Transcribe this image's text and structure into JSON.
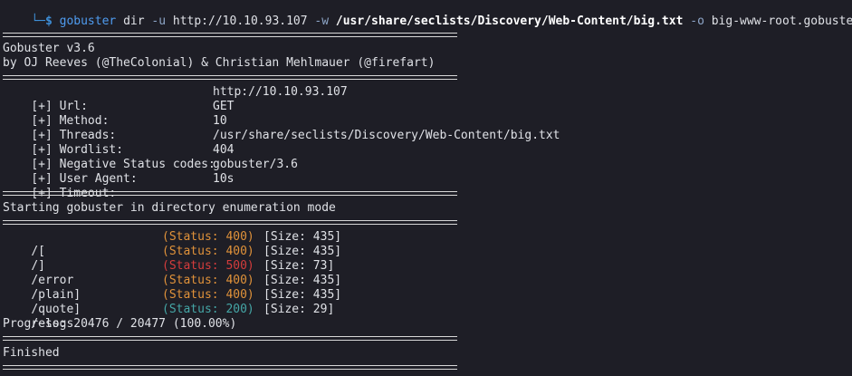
{
  "command": {
    "corner": "└─",
    "dollar": "$",
    "name": "gobuster",
    "subcommand": "dir",
    "url_flag": "-u",
    "url": "http://10.10.93.107",
    "wordlist_flag": "-w",
    "wordlist": "/usr/share/seclists/Discovery/Web-Content/big.txt",
    "output_flag": "-o",
    "output": "big-www-root.gobuster"
  },
  "banner": {
    "title": "Gobuster v3.6",
    "authors": "by OJ Reeves (@TheColonial) & Christian Mehlmauer (@firefart)"
  },
  "config": [
    {
      "label": "[+] Url:",
      "value": "http://10.10.93.107"
    },
    {
      "label": "[+] Method:",
      "value": "GET"
    },
    {
      "label": "[+] Threads:",
      "value": "10"
    },
    {
      "label": "[+] Wordlist:",
      "value": "/usr/share/seclists/Discovery/Web-Content/big.txt"
    },
    {
      "label": "[+] Negative Status codes:",
      "value": "404"
    },
    {
      "label": "[+] User Agent:",
      "value": "gobuster/3.6"
    },
    {
      "label": "[+] Timeout:",
      "value": "10s"
    }
  ],
  "start_message": "Starting gobuster in directory enumeration mode",
  "results": [
    {
      "path": "/[",
      "status": "(Status: 400)",
      "size": "[Size: 435]"
    },
    {
      "path": "/]",
      "status": "(Status: 400)",
      "size": "[Size: 435]"
    },
    {
      "path": "/error",
      "status": "(Status: 500)",
      "size": "[Size: 73]"
    },
    {
      "path": "/plain]",
      "status": "(Status: 400)",
      "size": "[Size: 435]"
    },
    {
      "path": "/quote]",
      "status": "(Status: 400)",
      "size": "[Size: 435]"
    },
    {
      "path": "/~logs",
      "status": "(Status: 200)",
      "size": "[Size: 29]"
    }
  ],
  "progress": "Progress: 20476 / 20477 (100.00%)",
  "finished": "Finished",
  "colors": {
    "background": "#1e1e26",
    "status_400": "#e0923a",
    "status_500": "#d43c3c",
    "status_200": "#45a6a6",
    "prompt": "#3e8fd8"
  }
}
